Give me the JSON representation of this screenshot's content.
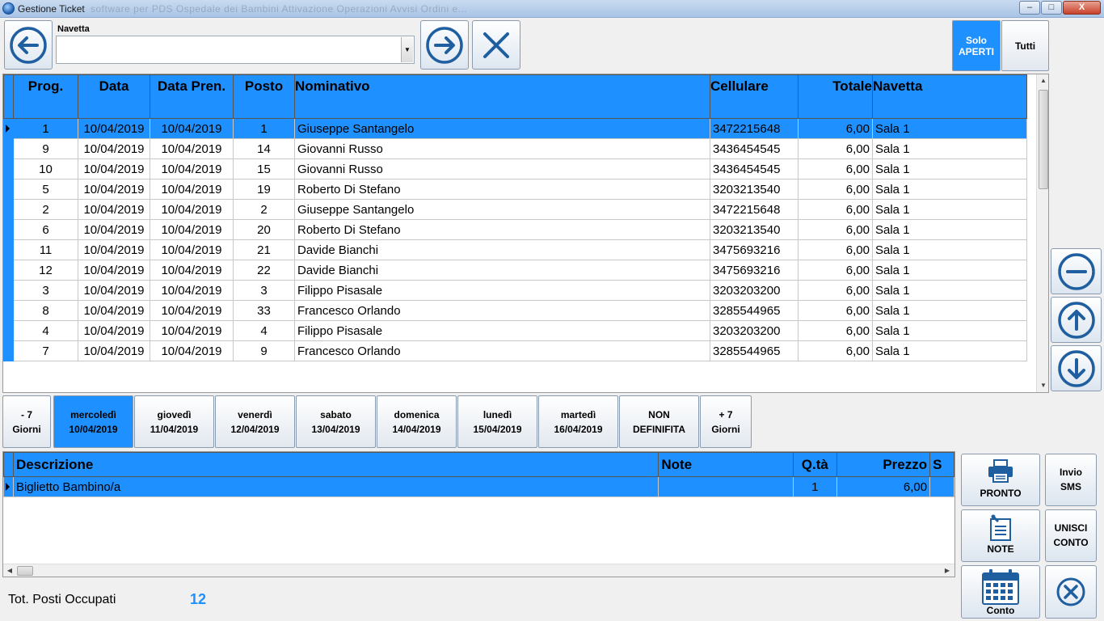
{
  "window": {
    "title": "Gestione Ticket",
    "blurred_title": "software per PDS   Ospedale dei Bambini   Attivazione   Operazioni   Avvisi   Ordini e...",
    "controls": {
      "minimize": "–",
      "maximize": "□",
      "close": "X"
    }
  },
  "toolbar": {
    "navetta_label": "Navetta",
    "navetta_value": "",
    "filter_open_label": "Solo APERTI",
    "filter_all_label": "Tutti"
  },
  "grid": {
    "columns": [
      "Prog.",
      "Data",
      "Data Pren.",
      "Posto",
      "Nominativo",
      "Cellulare",
      "Totale",
      "Navetta"
    ],
    "rows": [
      [
        "1",
        "10/04/2019",
        "10/04/2019",
        "1",
        "Giuseppe Santangelo",
        "3472215648",
        "6,00",
        "Sala 1"
      ],
      [
        "9",
        "10/04/2019",
        "10/04/2019",
        "14",
        "Giovanni Russo",
        "3436454545",
        "6,00",
        "Sala 1"
      ],
      [
        "10",
        "10/04/2019",
        "10/04/2019",
        "15",
        "Giovanni Russo",
        "3436454545",
        "6,00",
        "Sala 1"
      ],
      [
        "5",
        "10/04/2019",
        "10/04/2019",
        "19",
        "Roberto Di Stefano",
        "3203213540",
        "6,00",
        "Sala 1"
      ],
      [
        "2",
        "10/04/2019",
        "10/04/2019",
        "2",
        "Giuseppe Santangelo",
        "3472215648",
        "6,00",
        "Sala 1"
      ],
      [
        "6",
        "10/04/2019",
        "10/04/2019",
        "20",
        "Roberto Di Stefano",
        "3203213540",
        "6,00",
        "Sala 1"
      ],
      [
        "11",
        "10/04/2019",
        "10/04/2019",
        "21",
        "Davide Bianchi",
        "3475693216",
        "6,00",
        "Sala 1"
      ],
      [
        "12",
        "10/04/2019",
        "10/04/2019",
        "22",
        "Davide Bianchi",
        "3475693216",
        "6,00",
        "Sala 1"
      ],
      [
        "3",
        "10/04/2019",
        "10/04/2019",
        "3",
        "Filippo Pisasale",
        "3203203200",
        "6,00",
        "Sala 1"
      ],
      [
        "8",
        "10/04/2019",
        "10/04/2019",
        "33",
        "Francesco Orlando",
        "3285544965",
        "6,00",
        "Sala 1"
      ],
      [
        "4",
        "10/04/2019",
        "10/04/2019",
        "4",
        "Filippo Pisasale",
        "3203203200",
        "6,00",
        "Sala 1"
      ],
      [
        "7",
        "10/04/2019",
        "10/04/2019",
        "9",
        "Francesco Orlando",
        "3285544965",
        "6,00",
        "Sala 1"
      ]
    ],
    "selected_row": 0
  },
  "days": [
    {
      "line1": "- 7",
      "line2": "Giorni"
    },
    {
      "line1": "mercoledì",
      "line2": "10/04/2019",
      "active": true
    },
    {
      "line1": "giovedì",
      "line2": "11/04/2019"
    },
    {
      "line1": "venerdì",
      "line2": "12/04/2019"
    },
    {
      "line1": "sabato",
      "line2": "13/04/2019"
    },
    {
      "line1": "domenica",
      "line2": "14/04/2019"
    },
    {
      "line1": "lunedì",
      "line2": "15/04/2019"
    },
    {
      "line1": "martedì",
      "line2": "16/04/2019"
    },
    {
      "line1": "NON",
      "line2": "DEFINIFITA"
    },
    {
      "line1": "+ 7",
      "line2": "Giorni"
    }
  ],
  "detail": {
    "columns": [
      "Descrizione",
      "Note",
      "Q.tà",
      "Prezzo",
      "S"
    ],
    "rows": [
      [
        "Biglietto Bambino/a",
        "",
        "1",
        "6,00",
        ""
      ]
    ]
  },
  "footer": {
    "tot_label": "Tot. Posti Occupati",
    "tot_value": "12"
  },
  "actions": {
    "pronto": "PRONTO",
    "invio_sms_1": "Invio",
    "invio_sms_2": "SMS",
    "note": "NOTE",
    "unisci_1": "UNISCI",
    "unisci_2": "CONTO",
    "conto": "Conto"
  },
  "colors": {
    "accent": "#1e90ff",
    "icon": "#1f5f9f"
  }
}
